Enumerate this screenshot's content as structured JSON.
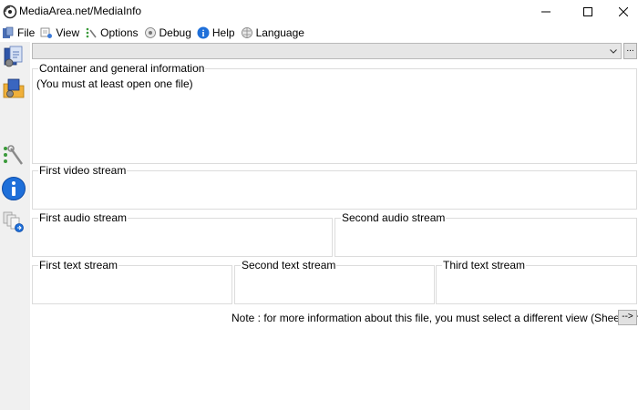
{
  "window": {
    "title": "MediaArea.net/MediaInfo"
  },
  "menu": {
    "items": [
      {
        "label": "File",
        "icon": "file-icon"
      },
      {
        "label": "View",
        "icon": "view-icon"
      },
      {
        "label": "Options",
        "icon": "options-icon"
      },
      {
        "label": "Debug",
        "icon": "debug-icon"
      },
      {
        "label": "Help",
        "icon": "help-icon"
      },
      {
        "label": "Language",
        "icon": "language-icon"
      }
    ]
  },
  "toolbar": {
    "tools": [
      {
        "name": "open-file-icon"
      },
      {
        "name": "open-folder-icon"
      },
      {
        "name": "options-tool-icon"
      },
      {
        "name": "about-icon"
      },
      {
        "name": "export-icon"
      }
    ]
  },
  "file_selector": {
    "value": "",
    "browse_label": "..."
  },
  "sections": {
    "general": {
      "title": "Container and general information",
      "content": "(You must at least open one file)"
    },
    "video": {
      "title": "First video stream"
    },
    "audio1": {
      "title": "First audio stream"
    },
    "audio2": {
      "title": "Second audio stream"
    },
    "text1": {
      "title": "First text stream"
    },
    "text2": {
      "title": "Second text stream"
    },
    "text3": {
      "title": "Third text stream"
    }
  },
  "note": {
    "text": "Note : for more information about this file, you must select a different view (Sheet, Tree...)",
    "button_label": "-->"
  },
  "colors": {
    "toolbar_bg": "#f0f0f0",
    "border": "#dcdcdc",
    "help_blue": "#1e6fd9"
  }
}
